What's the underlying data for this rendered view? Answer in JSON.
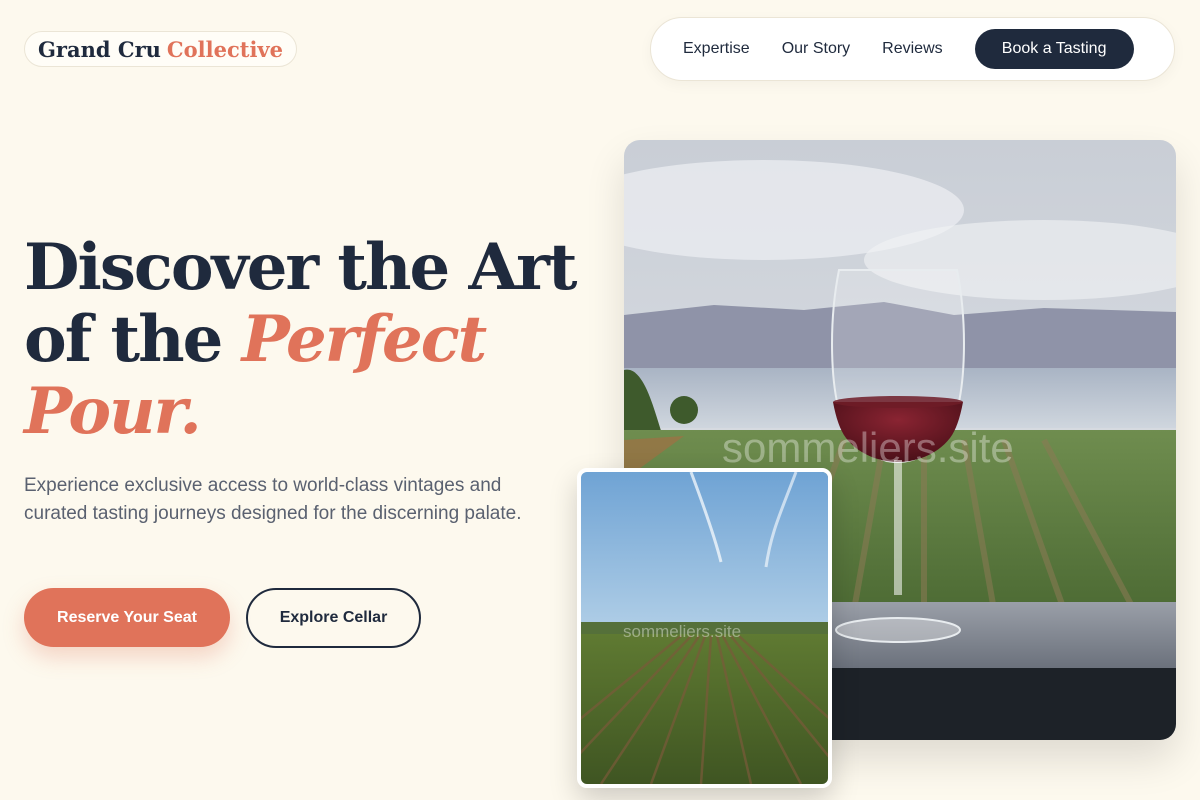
{
  "brand": {
    "name_part1": "Grand Cru",
    "name_part2": "Collective",
    "accent_color": "#e0735a",
    "dark_color": "#1f2a3d",
    "background_color": "#fdf9ee"
  },
  "nav": {
    "links": [
      {
        "label": "Expertise"
      },
      {
        "label": "Our Story"
      },
      {
        "label": "Reviews"
      }
    ],
    "cta_label": "Book a Tasting"
  },
  "hero": {
    "headline_line1": "Discover the Art",
    "headline_line2_plain": "of the",
    "headline_line2_accent": "Perfect",
    "headline_line3_accent": "Pour.",
    "lead": "Experience exclusive access to world-class vintages and curated tasting journeys designed for the discerning palate.",
    "primary_button": "Reserve Your Seat",
    "secondary_button": "Explore Cellar"
  },
  "images": {
    "main": {
      "subject": "red-wine-glass-vineyard-photo",
      "watermark": "sommeliers.site"
    },
    "inset": {
      "subject": "vineyard-rows-aerial-photo",
      "watermark": "sommeliers.site"
    }
  }
}
